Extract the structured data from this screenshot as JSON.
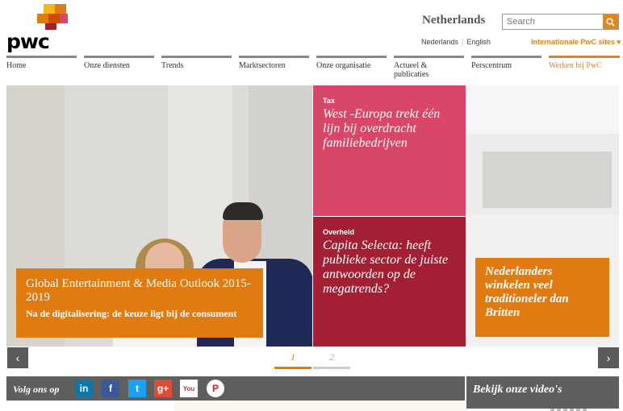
{
  "brand": {
    "logo_text": "pwc",
    "accent": "#e07b12",
    "logo_colors": [
      "#f5b81a",
      "#e07b12",
      "#d04a02",
      "#d8476a",
      "#a31f33"
    ]
  },
  "header": {
    "country": "Netherlands",
    "search_placeholder": "Search",
    "search_icon": "magnifier-icon",
    "languages": [
      "Nederlands",
      "English"
    ],
    "intl_sites": "Internationale PwC sites ▾"
  },
  "nav": [
    {
      "label": "Home"
    },
    {
      "label": "Onze diensten"
    },
    {
      "label": "Trends"
    },
    {
      "label": "Marktsectoren"
    },
    {
      "label": "Onze organisatie"
    },
    {
      "label": "Actueel & publicaties"
    },
    {
      "label": "Perscentrum"
    },
    {
      "label": "Werken bij PwC"
    }
  ],
  "hero": {
    "title": "Global Entertainment & Media Outlook 2015-2019",
    "subtitle": "Na de digitalisering: de keuze ligt bij de consument"
  },
  "tiles": {
    "tax": {
      "category": "Tax",
      "headline": "West -Europa trekt één lijn bij overdracht familiebedrijven"
    },
    "overheid": {
      "category": "Overheid",
      "headline": "Capita Selecta: heeft publieke sector de juiste antwoorden op de megatrends?"
    },
    "retail": {
      "headline": "Nederlanders winkelen veel traditioneler dan Britten"
    }
  },
  "carousel": {
    "prev": "‹",
    "next": "›",
    "pages": [
      {
        "label": "1",
        "active": true
      },
      {
        "label": "2",
        "active": false
      }
    ]
  },
  "social": {
    "label": "Volg ons op",
    "icons": [
      {
        "name": "linkedin-icon",
        "glyph": "in",
        "color": "#0e76a8"
      },
      {
        "name": "facebook-icon",
        "glyph": "f",
        "color": "#3b5998"
      },
      {
        "name": "twitter-icon",
        "glyph": "t",
        "color": "#1da1f2"
      },
      {
        "name": "google-plus-icon",
        "glyph": "g+",
        "color": "#dd4b39"
      },
      {
        "name": "youtube-icon",
        "glyph": "You",
        "color": "#ffffff"
      },
      {
        "name": "pinterest-icon",
        "glyph": "P",
        "color": "#cb2027"
      }
    ]
  },
  "videos": {
    "label": "Bekijk onze video's",
    "dots": 7,
    "active_dot": 0
  }
}
